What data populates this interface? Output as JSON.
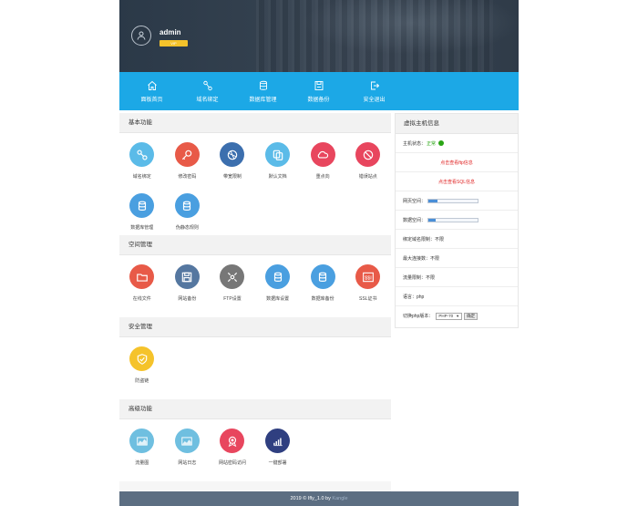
{
  "header": {
    "username": "admin",
    "level_badge": "VIP"
  },
  "nav": [
    {
      "label": "面板首页",
      "icon": "home-icon"
    },
    {
      "label": "域名绑定",
      "icon": "link-icon"
    },
    {
      "label": "数据库管理",
      "icon": "database-icon"
    },
    {
      "label": "数据备份",
      "icon": "save-icon"
    },
    {
      "label": "安全退出",
      "icon": "logout-icon"
    }
  ],
  "sections": {
    "basic": {
      "title": "基本功能",
      "tiles": [
        {
          "label": "域名绑定",
          "color": "#5bbbe8",
          "icon": "link-icon"
        },
        {
          "label": "修改密码",
          "color": "#e85a48",
          "icon": "key-icon"
        },
        {
          "label": "带宽限制",
          "color": "#3c6fae",
          "icon": "globe-icon"
        },
        {
          "label": "默认文档",
          "color": "#5bbbe8",
          "icon": "copy-icon"
        },
        {
          "label": "重点向",
          "color": "#e8465e",
          "icon": "cloud-icon"
        },
        {
          "label": "错误站点",
          "color": "#e8465e",
          "icon": "ban-icon"
        },
        {
          "label": "数据库管理",
          "color": "#4a9fe0",
          "icon": "database-icon"
        },
        {
          "label": "伪静态规则",
          "color": "#4a9fe0",
          "icon": "database-icon"
        }
      ]
    },
    "space": {
      "title": "空间管理",
      "tiles": [
        {
          "label": "在线文件",
          "color": "#e85a48",
          "icon": "folder-icon"
        },
        {
          "label": "网站备份",
          "color": "#5577a0",
          "icon": "floppy-icon"
        },
        {
          "label": "FTP设置",
          "color": "#777777",
          "icon": "ftp-icon"
        },
        {
          "label": "数据库设置",
          "color": "#4a9fe0",
          "icon": "database-icon"
        },
        {
          "label": "数据库备份",
          "color": "#4a9fe0",
          "icon": "database-icon"
        },
        {
          "label": "SSL证书",
          "color": "#e85a48",
          "icon": "ssl-icon"
        }
      ]
    },
    "security": {
      "title": "安全管理",
      "tiles": [
        {
          "label": "防盗链",
          "color": "#f5c32b",
          "icon": "shield-icon"
        }
      ]
    },
    "advanced": {
      "title": "高级功能",
      "tiles": [
        {
          "label": "流量图",
          "color": "#6fbfe0",
          "icon": "chart-area-icon"
        },
        {
          "label": "网站日志",
          "color": "#6fbfe0",
          "icon": "chart-area-icon"
        },
        {
          "label": "网站密码访问",
          "color": "#e8465e",
          "icon": "award-icon"
        },
        {
          "label": "一键部署",
          "color": "#2f3f80",
          "icon": "bar-chart-icon"
        }
      ]
    }
  },
  "side": {
    "title": "虚拟主机信息",
    "status_label": "主机状态：",
    "status_value": "正常",
    "link_ftp": "点击查看ftp信息",
    "link_sql": "点击查看SQL信息",
    "web_space_label": "网页空间：",
    "web_space_usage": 0.18,
    "db_space_label": "数据空间：",
    "db_space_usage": 0.15,
    "bind_limit": "绑定域名限制：不限",
    "max_conn": "最大连接数：不限",
    "traffic_limit": "流量限制：不限",
    "language": "语言：php",
    "php_switch_label": "切换php版本：",
    "php_version": "PHP-70",
    "confirm_button": "确定"
  },
  "footer": {
    "text": "2019 © Ifly_1.0 by ",
    "brand": "Kangle"
  }
}
